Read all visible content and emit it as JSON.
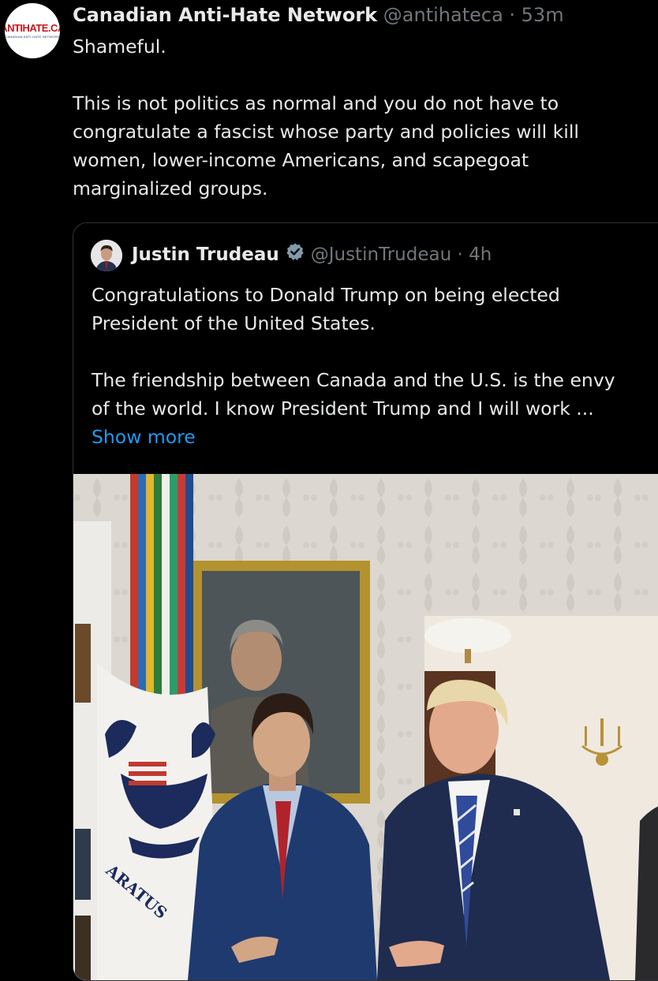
{
  "tweet": {
    "avatar": {
      "icon": "antihate-logo",
      "logo_text": "ANTIHATE.CA",
      "logo_subtext": "CANADIAN ANTI-HATE NETWORK"
    },
    "author_name": "Canadian Anti-Hate Network",
    "meta": "@antihateca · 53m",
    "text_lines": [
      "Shameful.",
      "This is not politics as normal and you do not have to",
      "congratulate a fascist whose party and policies will kill",
      "women, lower-income Americans, and scapegoat",
      "marginalized groups."
    ]
  },
  "quoted_tweet": {
    "author_name": "Justin Trudeau",
    "verified_icon": "verified-badge-icon",
    "meta": "@JustinTrudeau · 4h",
    "text_lines": [
      "Congratulations to Donald Trump on being elected",
      "President of the United States.",
      "The friendship between Canada and the U.S. is the envy",
      "of the world. I know President Trump and I will work ..."
    ],
    "show_more": "Show more",
    "photo": {
      "flag_text": "ARATUS"
    }
  },
  "colors": {
    "background": "#000000",
    "text": "#e7e9ea",
    "muted": "#71767b",
    "link": "#1d9bf0",
    "verified": "#829aab"
  }
}
